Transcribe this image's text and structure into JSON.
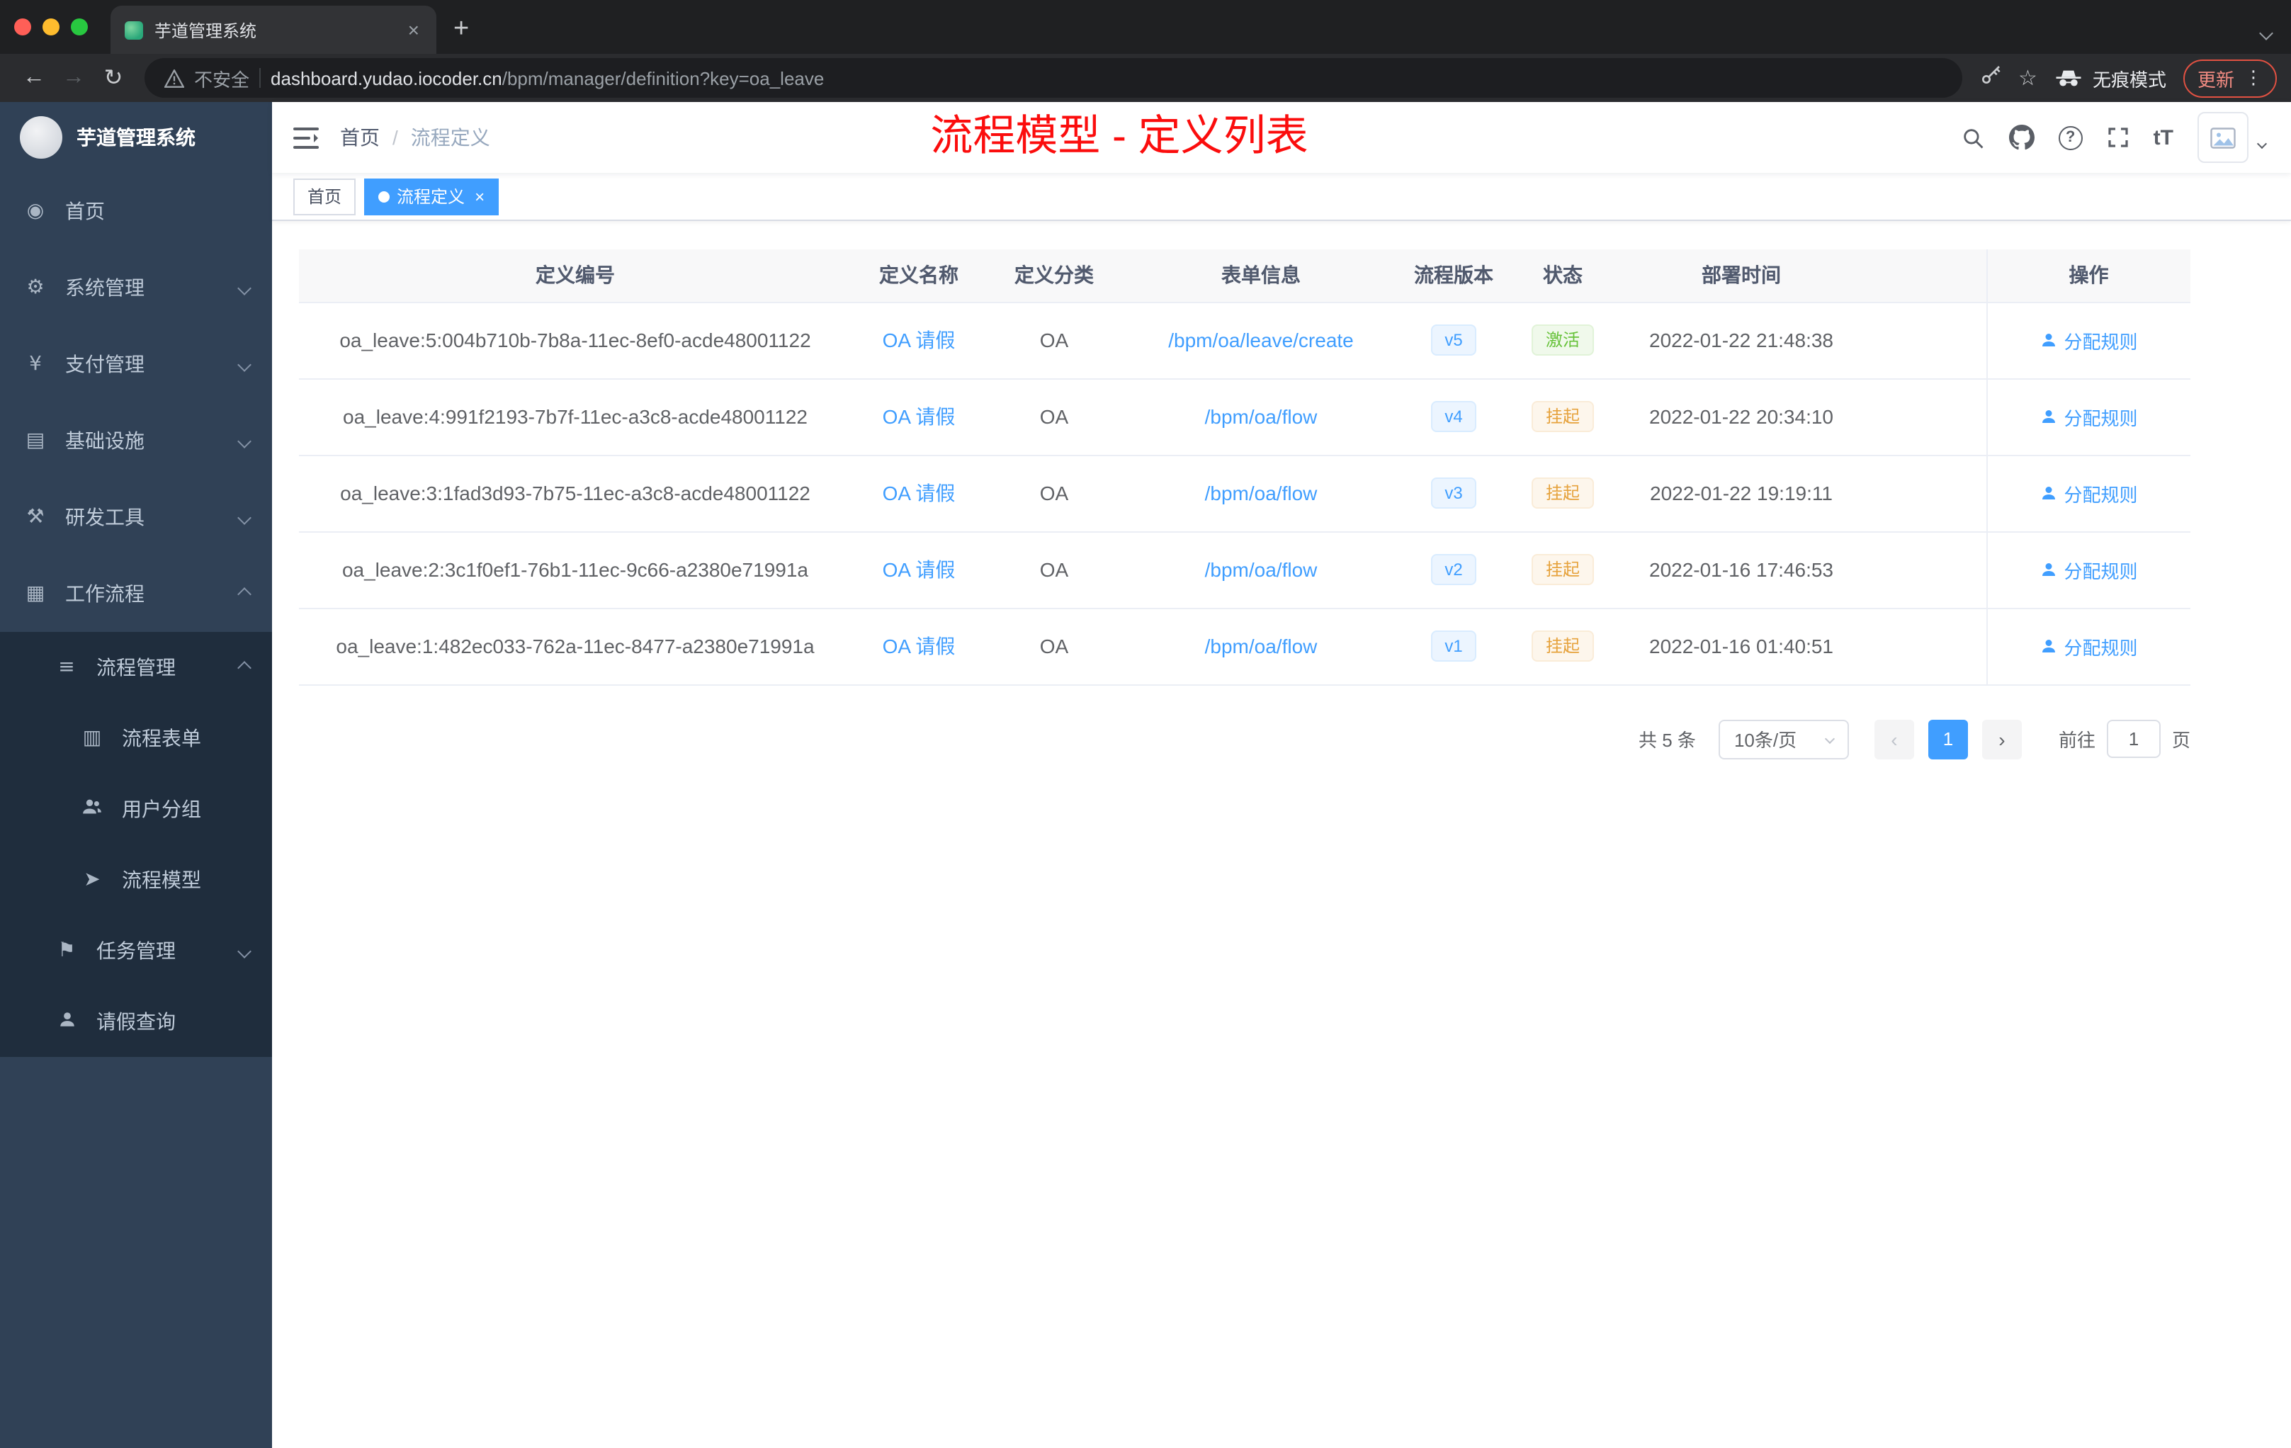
{
  "browser": {
    "tab_title": "芋道管理系统",
    "security_label": "不安全",
    "url_host": "dashboard.yudao.iocoder.cn",
    "url_path": "/bpm/manager/definition?key=oa_leave",
    "incognito_label": "无痕模式",
    "update_label": "更新"
  },
  "sidebar": {
    "app_title": "芋道管理系统",
    "items": [
      {
        "label": "首页",
        "icon": "dashboard-icon"
      },
      {
        "label": "系统管理",
        "icon": "gear-icon"
      },
      {
        "label": "支付管理",
        "icon": "yen-icon"
      },
      {
        "label": "基础设施",
        "icon": "infrastructure-icon"
      },
      {
        "label": "研发工具",
        "icon": "tools-icon"
      },
      {
        "label": "工作流程",
        "icon": "workflow-icon"
      }
    ],
    "process_mgmt": {
      "label": "流程管理",
      "icon": "list-icon"
    },
    "process_items": [
      {
        "label": "流程表单",
        "icon": "form-icon"
      },
      {
        "label": "用户分组",
        "icon": "user-group-icon"
      },
      {
        "label": "流程模型",
        "icon": "paper-plane-icon"
      }
    ],
    "task_mgmt": {
      "label": "任务管理",
      "icon": "flag-icon"
    },
    "leave_query": {
      "label": "请假查询",
      "icon": "person-icon"
    }
  },
  "header": {
    "breadcrumb_home": "首页",
    "breadcrumb_sep": "/",
    "breadcrumb_current": "流程定义",
    "annotation": "流程模型 - 定义列表",
    "font_size_label": "tT"
  },
  "tags": {
    "home": "首页",
    "current": "流程定义"
  },
  "table": {
    "columns": [
      "定义编号",
      "定义名称",
      "定义分类",
      "表单信息",
      "流程版本",
      "状态",
      "部署时间",
      "操作"
    ],
    "rows": [
      {
        "id": "oa_leave:5:004b710b-7b8a-11ec-8ef0-acde48001122",
        "name": "OA 请假",
        "category": "OA",
        "form": "/bpm/oa/leave/create",
        "version": "v5",
        "status": "激活",
        "status_type": "success",
        "deploy_time": "2022-01-22 21:48:38",
        "action": "分配规则"
      },
      {
        "id": "oa_leave:4:991f2193-7b7f-11ec-a3c8-acde48001122",
        "name": "OA 请假",
        "category": "OA",
        "form": "/bpm/oa/flow",
        "version": "v4",
        "status": "挂起",
        "status_type": "warning",
        "deploy_time": "2022-01-22 20:34:10",
        "action": "分配规则"
      },
      {
        "id": "oa_leave:3:1fad3d93-7b75-11ec-a3c8-acde48001122",
        "name": "OA 请假",
        "category": "OA",
        "form": "/bpm/oa/flow",
        "version": "v3",
        "status": "挂起",
        "status_type": "warning",
        "deploy_time": "2022-01-22 19:19:11",
        "action": "分配规则"
      },
      {
        "id": "oa_leave:2:3c1f0ef1-76b1-11ec-9c66-a2380e71991a",
        "name": "OA 请假",
        "category": "OA",
        "form": "/bpm/oa/flow",
        "version": "v2",
        "status": "挂起",
        "status_type": "warning",
        "deploy_time": "2022-01-16 17:46:53",
        "action": "分配规则"
      },
      {
        "id": "oa_leave:1:482ec033-762a-11ec-8477-a2380e71991a",
        "name": "OA 请假",
        "category": "OA",
        "form": "/bpm/oa/flow",
        "version": "v1",
        "status": "挂起",
        "status_type": "warning",
        "deploy_time": "2022-01-16 01:40:51",
        "action": "分配规则"
      }
    ]
  },
  "pagination": {
    "total": "共 5 条",
    "page_size": "10条/页",
    "page": "1",
    "goto_label": "前往",
    "goto_value": "1",
    "goto_unit": "页"
  },
  "colors": {
    "accent": "#409eff",
    "success": "#67c23a",
    "warning": "#e6a23c",
    "annotation_red": "#fb0d0d",
    "sidebar_bg": "#304156",
    "submenu_bg": "#1f2d3d"
  }
}
